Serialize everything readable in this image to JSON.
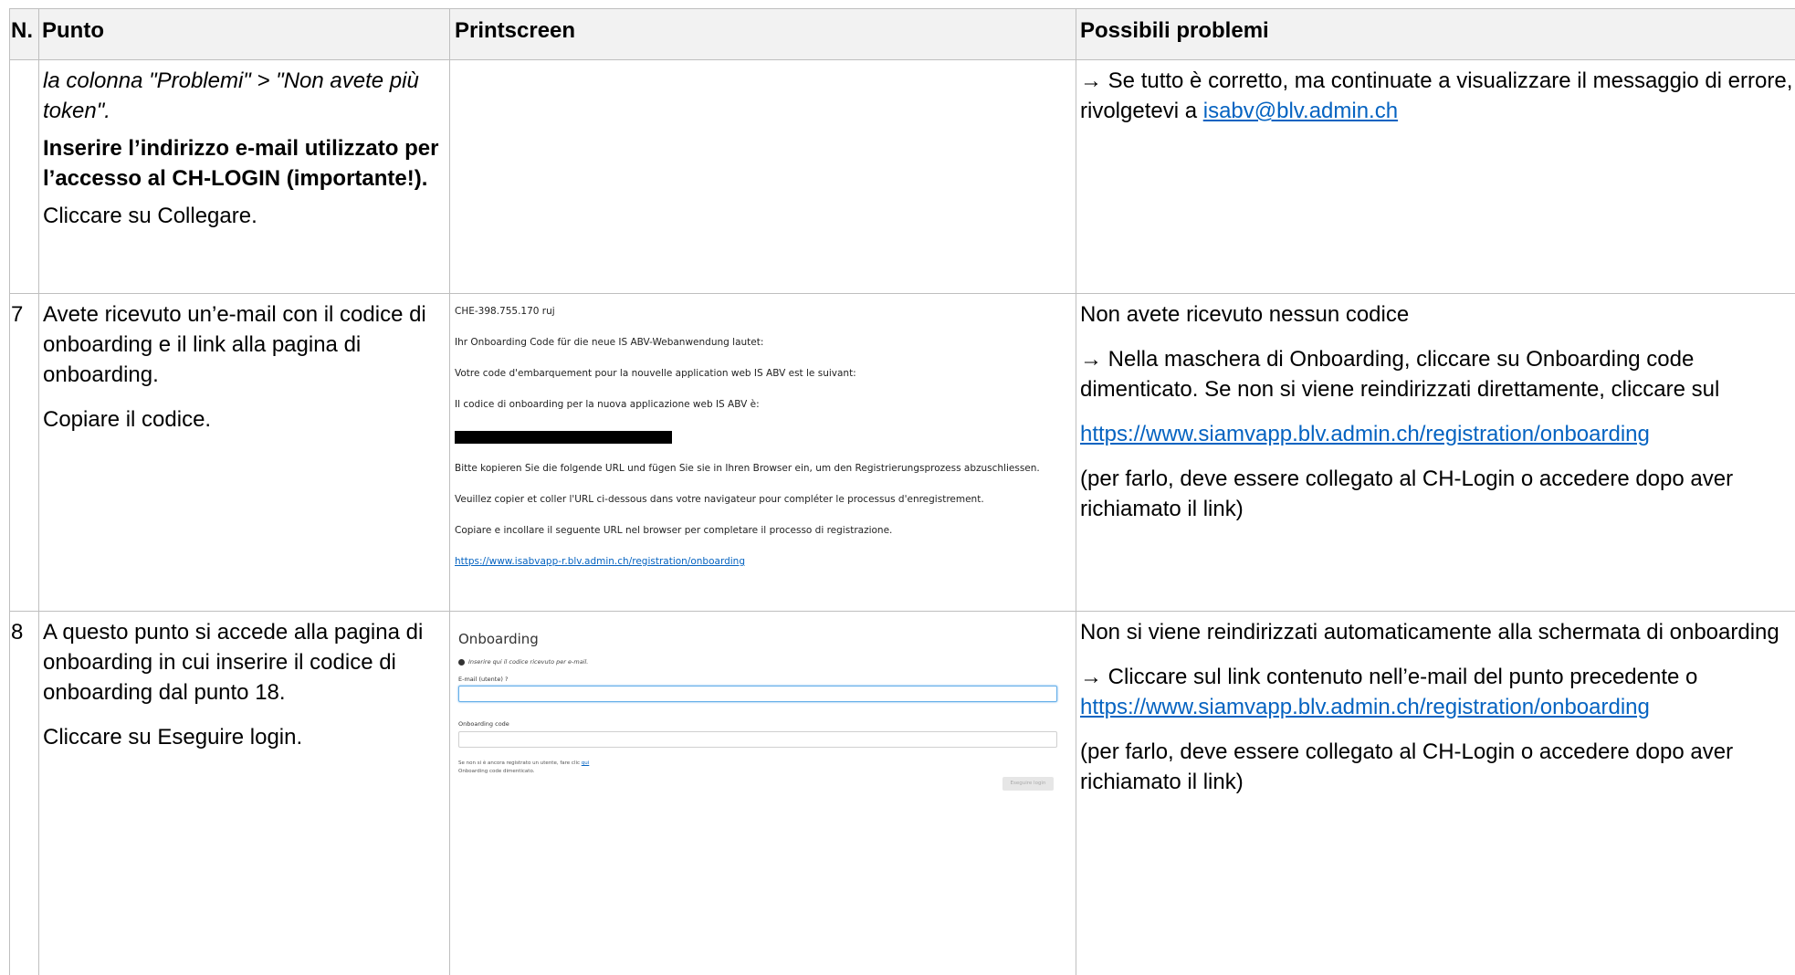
{
  "header": {
    "num": "N.",
    "punto": "Punto",
    "printscreen": "Printscreen",
    "problemi": "Possibili problemi"
  },
  "row_cont": {
    "step_italic": "la colonna \"Problemi\" > \"Non avete più token\".",
    "step_bold": "Inserire l’indirizzo e-mail utilizzato per l’accesso al CH-LOGIN (importante!).",
    "step_action": "Cliccare su Collegare.",
    "problem_text": "→ Se tutto è corretto, ma continuate a visualizzare il messaggio di errore, rivolgetevi a ",
    "problem_link": "isabv@blv.admin.ch"
  },
  "row7": {
    "num": "7",
    "step_text": "Avete ricevuto un’e-mail con il codice di onboarding e il link alla pagina di onboarding.",
    "step_action": "Copiare il codice.",
    "email": {
      "sender": "CHE-398.755.170  ruj",
      "line_de": "Ihr Onboarding Code für die neue IS ABV-Webanwendung lautet:",
      "line_fr": "Votre code d'embarquement pour la nouvelle application web IS ABV est le suivant:",
      "line_it": "Il codice di onboarding per la nuova applicazione web IS ABV è:",
      "copy_de": "Bitte kopieren Sie die folgende URL und fügen Sie sie in Ihren Browser ein, um den Registrierungsprozess abzuschliessen.",
      "copy_fr": "Veuillez copier et coller l'URL ci-dessous dans votre navigateur pour compléter le processus d'enregistrement.",
      "copy_it": "Copiare e incollare il seguente URL nel browser per completare il processo di registrazione.",
      "link": "https://www.isabvapp-r.blv.admin.ch/registration/onboarding"
    },
    "problem_title": "Non avete ricevuto nessun codice",
    "problem_text": "→ Nella maschera di Onboarding, cliccare su Onboarding code dimenticato. Se non si viene reindirizzati direttamente, cliccare sul",
    "problem_link": "https://www.siamvapp.blv.admin.ch/registration/onboarding",
    "problem_note": "(per farlo, deve essere collegato al CH-Login o accedere dopo aver richiamato il link)"
  },
  "row8": {
    "num": "8",
    "step_text": "A questo punto si accede alla pagina di onboarding in cui inserire il codice di onboarding dal punto 18.",
    "step_action": "Cliccare su Eseguire login.",
    "onboarding": {
      "title": "Onboarding",
      "info": "Inserire qui il codice ricevuto per e-mail.",
      "email_label": "E-mail (utente)",
      "code_label": "Onboarding code",
      "note_prefix": "Se non si è ancora registrato un utente, fare clic ",
      "note_link": "qui",
      "forgot": "Onboarding code dimenticato.",
      "button": "Eseguire login"
    },
    "problem_title": "Non si viene reindirizzati automaticamente alla schermata di onboarding",
    "problem_text": "→ Cliccare sul link contenuto nell’e-mail del punto precedente o ",
    "problem_link": "https://www.siamvapp.blv.admin.ch/registration/onboarding",
    "problem_note": "(per farlo, deve essere collegato al CH-Login o accedere dopo aver richiamato il link)"
  }
}
